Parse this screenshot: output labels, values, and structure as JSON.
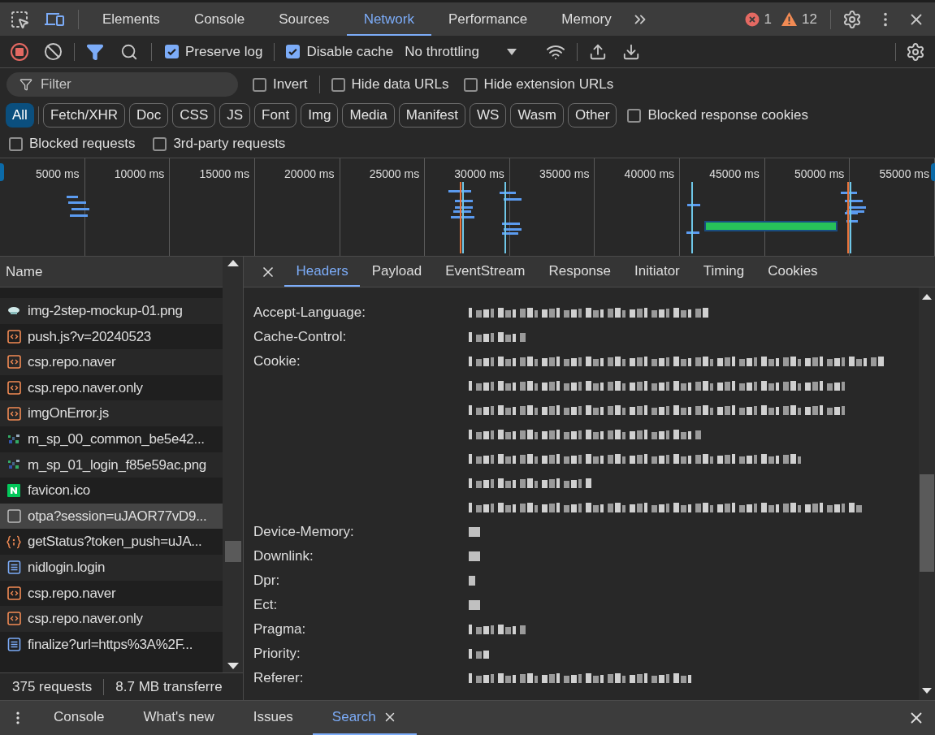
{
  "main_tabs": [
    {
      "label": "Elements",
      "selected": false
    },
    {
      "label": "Console",
      "selected": false
    },
    {
      "label": "Sources",
      "selected": false
    },
    {
      "label": "Network",
      "selected": true
    },
    {
      "label": "Performance",
      "selected": false
    },
    {
      "label": "Memory",
      "selected": false
    }
  ],
  "counts": {
    "errors": "1",
    "warnings": "12"
  },
  "toolbar": {
    "recording": true,
    "options": [
      {
        "label": "Preserve log",
        "checked": true
      },
      {
        "label": "Disable cache",
        "checked": true
      }
    ],
    "throttling": "No throttling"
  },
  "filter": {
    "placeholder": "Filter",
    "options": [
      {
        "label": "Invert",
        "checked": false
      },
      {
        "label": "Hide data URLs",
        "checked": false
      },
      {
        "label": "Hide extension URLs",
        "checked": false
      }
    ]
  },
  "types": [
    {
      "label": "All",
      "selected": true
    },
    {
      "label": "Fetch/XHR",
      "selected": false
    },
    {
      "label": "Doc",
      "selected": false
    },
    {
      "label": "CSS",
      "selected": false
    },
    {
      "label": "JS",
      "selected": false
    },
    {
      "label": "Font",
      "selected": false
    },
    {
      "label": "Img",
      "selected": false
    },
    {
      "label": "Media",
      "selected": false
    },
    {
      "label": "Manifest",
      "selected": false
    },
    {
      "label": "WS",
      "selected": false
    },
    {
      "label": "Wasm",
      "selected": false
    },
    {
      "label": "Other",
      "selected": false
    }
  ],
  "blocked_cookies": {
    "label": "Blocked response cookies",
    "checked": false
  },
  "extra_options": [
    {
      "label": "Blocked requests",
      "checked": false
    },
    {
      "label": "3rd-party requests",
      "checked": false
    }
  ],
  "timeline": {
    "ticks": [
      "5000 ms",
      "10000 ms",
      "15000 ms",
      "20000 ms",
      "25000 ms",
      "30000 ms",
      "35000 ms",
      "40000 ms",
      "45000 ms",
      "50000 ms",
      "55000 ms"
    ]
  },
  "requests": {
    "column": "Name",
    "rows": [
      {
        "name": "img-2step-mockup-01.png",
        "kind": "image",
        "selected": false
      },
      {
        "name": "push.js?v=20240523",
        "kind": "script",
        "selected": false
      },
      {
        "name": "csp.repo.naver",
        "kind": "script",
        "selected": false
      },
      {
        "name": "csp.repo.naver.only",
        "kind": "script",
        "selected": false
      },
      {
        "name": "imgOnError.js",
        "kind": "script",
        "selected": false
      },
      {
        "name": "m_sp_00_common_be5e42...",
        "kind": "sprite",
        "selected": false
      },
      {
        "name": "m_sp_01_login_f85e59ac.png",
        "kind": "sprite",
        "selected": false
      },
      {
        "name": "favicon.ico",
        "kind": "favicon",
        "selected": false
      },
      {
        "name": "otpa?session=uJAOR77vD9...",
        "kind": "other",
        "selected": true
      },
      {
        "name": "getStatus?token_push=uJA...",
        "kind": "fetch",
        "selected": false
      },
      {
        "name": "nidlogin.login",
        "kind": "document",
        "selected": false
      },
      {
        "name": "csp.repo.naver",
        "kind": "script",
        "selected": false
      },
      {
        "name": "csp.repo.naver.only",
        "kind": "script",
        "selected": false
      },
      {
        "name": "finalize?url=https%3A%2F...",
        "kind": "document",
        "selected": false
      }
    ]
  },
  "status": {
    "requests": "375 requests",
    "transferred": "8.7 MB transferre"
  },
  "detail_tabs": [
    {
      "label": "Headers",
      "selected": true
    },
    {
      "label": "Payload",
      "selected": false
    },
    {
      "label": "EventStream",
      "selected": false
    },
    {
      "label": "Response",
      "selected": false
    },
    {
      "label": "Initiator",
      "selected": false
    },
    {
      "label": "Timing",
      "selected": false
    },
    {
      "label": "Cookies",
      "selected": false
    }
  ],
  "headers": [
    {
      "name": "Accept-Language:"
    },
    {
      "name": "Cache-Control:"
    },
    {
      "name": "Cookie:"
    },
    {
      "name": "Device-Memory:"
    },
    {
      "name": "Downlink:"
    },
    {
      "name": "Dpr:"
    },
    {
      "name": "Ect:"
    },
    {
      "name": "Pragma:"
    },
    {
      "name": "Priority:"
    },
    {
      "name": "Referer:"
    }
  ],
  "drawer_tabs": [
    {
      "label": "Console",
      "selected": false
    },
    {
      "label": "What's new",
      "selected": false
    },
    {
      "label": "Issues",
      "selected": false
    },
    {
      "label": "Search",
      "selected": true
    }
  ]
}
